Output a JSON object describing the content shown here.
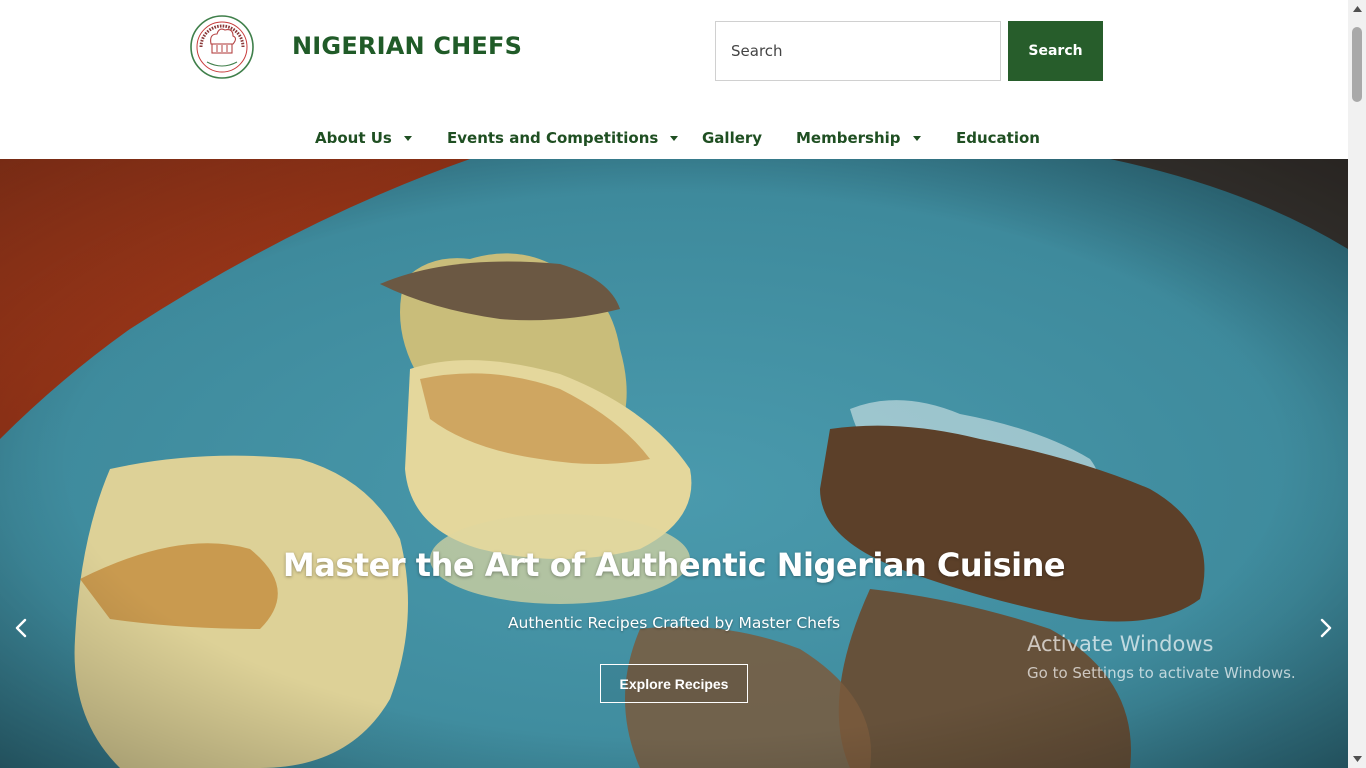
{
  "colors": {
    "brand_green": "#205b28",
    "nav_text": "#1f4f22",
    "search_button": "#275d2b",
    "hero_overlay_text": "#ffffff"
  },
  "header": {
    "brand_name": "NIGERIAN CHEFS",
    "logo_icon": "chef-hat-seal-logo"
  },
  "search": {
    "placeholder": "Search",
    "value": "",
    "button_label": "Search"
  },
  "nav": {
    "items": [
      {
        "label": "About Us",
        "has_dropdown": true
      },
      {
        "label": "Events and Competitions",
        "has_dropdown": true
      },
      {
        "label": "Gallery",
        "has_dropdown": false
      },
      {
        "label": "Membership",
        "has_dropdown": true
      },
      {
        "label": "Education",
        "has_dropdown": false
      }
    ]
  },
  "hero": {
    "title": "Master the Art of Authentic Nigerian Cuisine",
    "subtitle": "Authentic Recipes Crafted by Master Chefs",
    "button_label": "Explore Recipes",
    "prev_icon": "chevron-left-icon",
    "next_icon": "chevron-right-icon"
  },
  "watermark": {
    "title": "Activate Windows",
    "subtitle": "Go to Settings to activate Windows."
  }
}
